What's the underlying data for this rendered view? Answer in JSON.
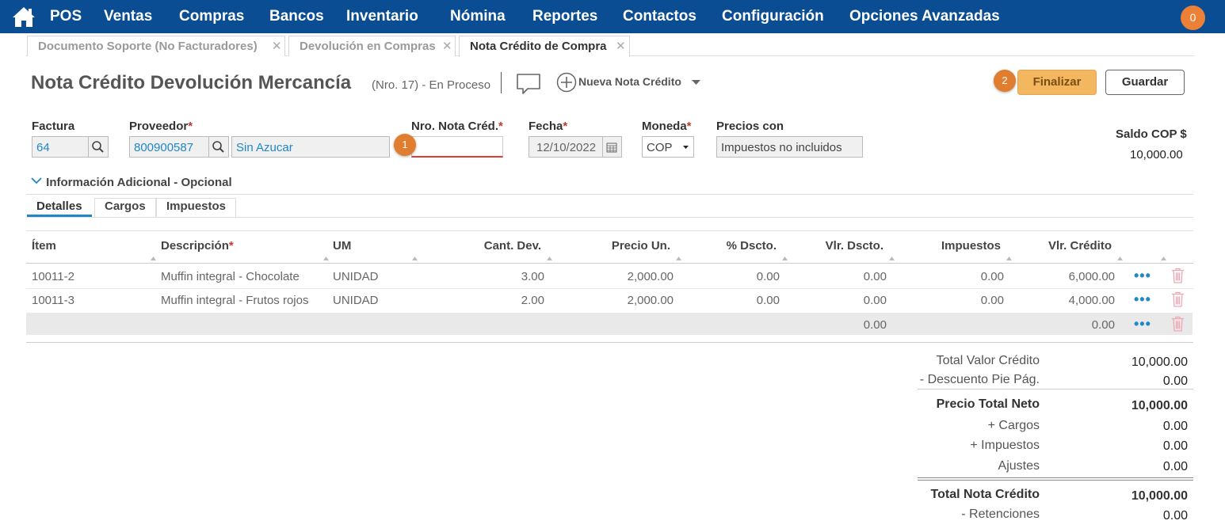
{
  "nav": {
    "items": [
      "POS",
      "Ventas",
      "Compras",
      "Bancos",
      "Inventario",
      "Nómina",
      "Reportes",
      "Contactos",
      "Configuración",
      "Opciones Avanzadas"
    ],
    "notifications": "0"
  },
  "tabs": [
    {
      "label": "Documento Soporte (No Facturadores)"
    },
    {
      "label": "Devolución en Compras"
    },
    {
      "label": "Nota Crédito de Compra"
    }
  ],
  "header": {
    "title": "Nota Crédito Devolución Mercancía",
    "subtitle": "(Nro. 17) - En Proceso",
    "new_note_label": "Nueva Nota Crédito",
    "finalize_label": "Finalizar",
    "save_label": "Guardar",
    "badge_finalize": "2",
    "badge_nro": "1"
  },
  "form": {
    "factura_label": "Factura",
    "factura_value": "64",
    "proveedor_label": "Proveedor",
    "proveedor_nit": "800900587",
    "proveedor_name": "Sin Azucar",
    "nro_label": "Nro. Nota Créd.",
    "nro_value": "",
    "fecha_label": "Fecha",
    "fecha_value": "12/10/2022",
    "moneda_label": "Moneda",
    "moneda_value": "COP",
    "precios_label": "Precios con",
    "precios_value": "Impuestos no incluidos",
    "required_mark": "*",
    "saldo_label": "Saldo COP $",
    "saldo_value": "10,000.00"
  },
  "info_adicional": "Información Adicional - Opcional",
  "subtabs": [
    "Detalles",
    "Cargos",
    "Impuestos"
  ],
  "table": {
    "headers": [
      "Ítem",
      "Descripción",
      "UM",
      "Cant. Dev.",
      "Precio Un.",
      "% Dscto.",
      "Vlr. Dscto.",
      "Impuestos",
      "Vlr. Crédito"
    ],
    "rows": [
      {
        "item": "10011-2",
        "desc": "Muffin integral - Chocolate",
        "um": "UNIDAD",
        "cant": "3.00",
        "precio": "2,000.00",
        "pdesc": "0.00",
        "vdesc": "0.00",
        "imp": "0.00",
        "credito": "6,000.00"
      },
      {
        "item": "10011-3",
        "desc": "Muffin integral - Frutos rojos",
        "um": "UNIDAD",
        "cant": "2.00",
        "precio": "2,000.00",
        "pdesc": "0.00",
        "vdesc": "0.00",
        "imp": "0.00",
        "credito": "4,000.00"
      }
    ],
    "totals_row": {
      "vdesc": "0.00",
      "credito": "0.00"
    },
    "more_glyph": "•••"
  },
  "summary": [
    {
      "label": "Total Valor Crédito",
      "value": "10,000.00"
    },
    {
      "label": "- Descuento Pie Pág.",
      "value": "0.00"
    },
    {
      "label": "Precio Total Neto",
      "value": "10,000.00"
    },
    {
      "label": "+ Cargos",
      "value": "0.00"
    },
    {
      "label": "+ Impuestos",
      "value": "0.00"
    },
    {
      "label": "Ajustes",
      "value": "0.00"
    },
    {
      "label": "Total Nota Crédito",
      "value": "10,000.00"
    },
    {
      "label": "- Retenciones",
      "value": "0.00"
    }
  ],
  "colors": {
    "nav_bg": "#0a4d93",
    "accent": "#1e88c8",
    "finalize": "#f3b75f",
    "badge": "#e07d2e"
  }
}
